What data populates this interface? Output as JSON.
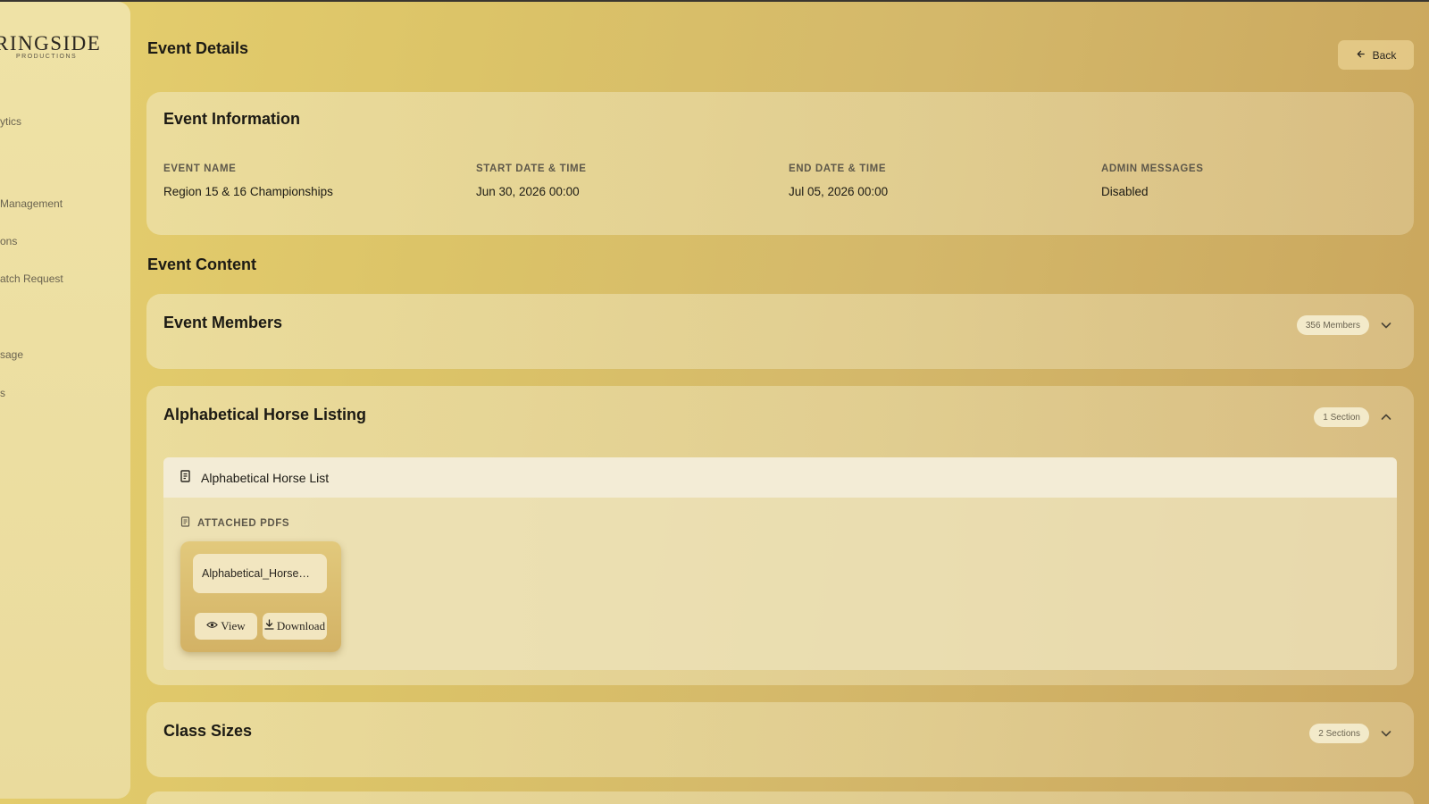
{
  "app": {
    "logo_main": "RINGSIDE",
    "logo_sub": "PRODUCTIONS"
  },
  "sidebar": {
    "items": [
      {
        "label": "ytics"
      },
      {
        "label": "Management"
      },
      {
        "label": "ons"
      },
      {
        "label": "atch Request"
      },
      {
        "label": "sage"
      },
      {
        "label": "s"
      }
    ]
  },
  "page": {
    "title": "Event Details",
    "back_label": "Back"
  },
  "event_info": {
    "title": "Event Information",
    "fields": [
      {
        "label": "EVENT NAME",
        "value": "Region 15 & 16 Championships"
      },
      {
        "label": "START DATE & TIME",
        "value": "Jun 30, 2026 00:00"
      },
      {
        "label": "END DATE & TIME",
        "value": "Jul 05, 2026 00:00"
      },
      {
        "label": "ADMIN MESSAGES",
        "value": "Disabled"
      }
    ]
  },
  "content": {
    "title": "Event Content",
    "members": {
      "title": "Event Members",
      "badge": "356 Members",
      "expanded": false
    },
    "horse_listing": {
      "title": "Alphabetical Horse Listing",
      "badge": "1 Section",
      "expanded": true,
      "section": {
        "title": "Alphabetical Horse List",
        "attached_label": "ATTACHED PDFS",
        "pdfs": [
          {
            "name": "Alphabetical_Horse…",
            "view_label": "View",
            "download_label": "Download"
          }
        ]
      }
    },
    "class_sizes": {
      "title": "Class Sizes",
      "badge": "2 Sections",
      "expanded": false
    }
  },
  "colors": {
    "background": "#dcc468",
    "sidebar": "#efe2a6",
    "accent": "#d3b265"
  }
}
